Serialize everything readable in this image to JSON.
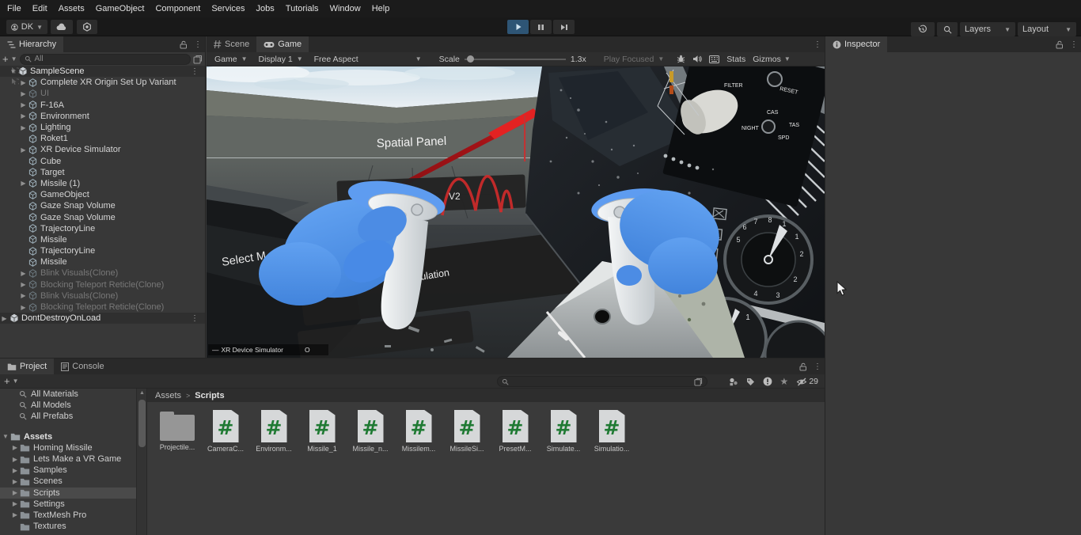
{
  "menu": {
    "items": [
      "File",
      "Edit",
      "Assets",
      "GameObject",
      "Component",
      "Services",
      "Jobs",
      "Tutorials",
      "Window",
      "Help"
    ]
  },
  "toolbar": {
    "account_label": "DK",
    "layers_label": "Layers",
    "layout_label": "Layout"
  },
  "hierarchy": {
    "title": "Hierarchy",
    "search_placeholder": "All",
    "scene_name": "SampleScene",
    "items": [
      {
        "label": "Complete XR Origin Set Up Variant",
        "arrow": true,
        "dim": false
      },
      {
        "label": "UI",
        "arrow": true,
        "dim": true
      },
      {
        "label": "F-16A",
        "arrow": true,
        "dim": false
      },
      {
        "label": "Environment",
        "arrow": true,
        "dim": false
      },
      {
        "label": "Lighting",
        "arrow": true,
        "dim": false
      },
      {
        "label": "Roket1",
        "arrow": false,
        "dim": false
      },
      {
        "label": "XR Device Simulator",
        "arrow": true,
        "dim": false
      },
      {
        "label": "Cube",
        "arrow": false,
        "dim": false
      },
      {
        "label": "Target",
        "arrow": false,
        "dim": false
      },
      {
        "label": "Missile (1)",
        "arrow": true,
        "dim": false
      },
      {
        "label": "GameObject",
        "arrow": false,
        "dim": false
      },
      {
        "label": "Gaze Snap Volume",
        "arrow": false,
        "dim": false
      },
      {
        "label": "Gaze Snap Volume",
        "arrow": false,
        "dim": false
      },
      {
        "label": "TrajectoryLine",
        "arrow": false,
        "dim": false
      },
      {
        "label": "Missile",
        "arrow": false,
        "dim": false
      },
      {
        "label": "TrajectoryLine",
        "arrow": false,
        "dim": false
      },
      {
        "label": "Missile",
        "arrow": false,
        "dim": false
      },
      {
        "label": "Blink Visuals(Clone)",
        "arrow": true,
        "dim": true
      },
      {
        "label": "Blocking Teleport Reticle(Clone)",
        "arrow": true,
        "dim": true
      },
      {
        "label": "Blink Visuals(Clone)",
        "arrow": true,
        "dim": true
      },
      {
        "label": "Blocking Teleport Reticle(Clone)",
        "arrow": true,
        "dim": true
      }
    ],
    "bottom_scene": "DontDestroyOnLoad"
  },
  "game": {
    "tab_scene": "Scene",
    "tab_game": "Game",
    "display_dropdown": "Game",
    "display_target": "Display 1",
    "aspect": "Free Aspect",
    "scale_label": "Scale",
    "scale_value": "1.3x",
    "play_focused": "Play Focused",
    "stats": "Stats",
    "gizmos": "Gizmos",
    "scene": {
      "spatial_panel": "Spatial Panel",
      "select_menu": "Select M",
      "v2": "V2",
      "simulation": "imulation",
      "xr_sim_dash": "—",
      "xr_sim_label": "XR Device Simulator",
      "xr_sim_o": "O",
      "lbl_filter": "FILTER",
      "lbl_reset": "RESET",
      "lbl_cas": "CAS",
      "lbl_tas": "TAS",
      "lbl_night": "NIGHT",
      "lbl_spd": "SPD"
    }
  },
  "inspector": {
    "title": "Inspector"
  },
  "project": {
    "tab_project": "Project",
    "tab_console": "Console",
    "favorites": [
      "All Materials",
      "All Models",
      "All Prefabs"
    ],
    "root": "Assets",
    "folders": [
      {
        "label": "Homing Missile",
        "arrow": true,
        "sel": false
      },
      {
        "label": "Lets Make a VR Game",
        "arrow": true,
        "sel": false
      },
      {
        "label": "Samples",
        "arrow": true,
        "sel": false
      },
      {
        "label": "Scenes",
        "arrow": true,
        "sel": false
      },
      {
        "label": "Scripts",
        "arrow": true,
        "sel": true
      },
      {
        "label": "Settings",
        "arrow": true,
        "sel": false
      },
      {
        "label": "TextMesh Pro",
        "arrow": true,
        "sel": false
      },
      {
        "label": "Textures",
        "arrow": false,
        "sel": false
      }
    ],
    "breadcrumb_root": "Assets",
    "breadcrumb_sep": ">",
    "breadcrumb_current": "Scripts",
    "files": [
      {
        "name": "Projectile...",
        "type": "folder"
      },
      {
        "name": "CameraC...",
        "type": "cs"
      },
      {
        "name": "Environm...",
        "type": "cs"
      },
      {
        "name": "Missile_1",
        "type": "cs"
      },
      {
        "name": "Missile_n...",
        "type": "cs"
      },
      {
        "name": "Missilem...",
        "type": "cs"
      },
      {
        "name": "MissileSi...",
        "type": "cs"
      },
      {
        "name": "PresetM...",
        "type": "cs"
      },
      {
        "name": "Simulate...",
        "type": "cs"
      },
      {
        "name": "Simulatio...",
        "type": "cs"
      }
    ],
    "hidden_count": "29"
  }
}
